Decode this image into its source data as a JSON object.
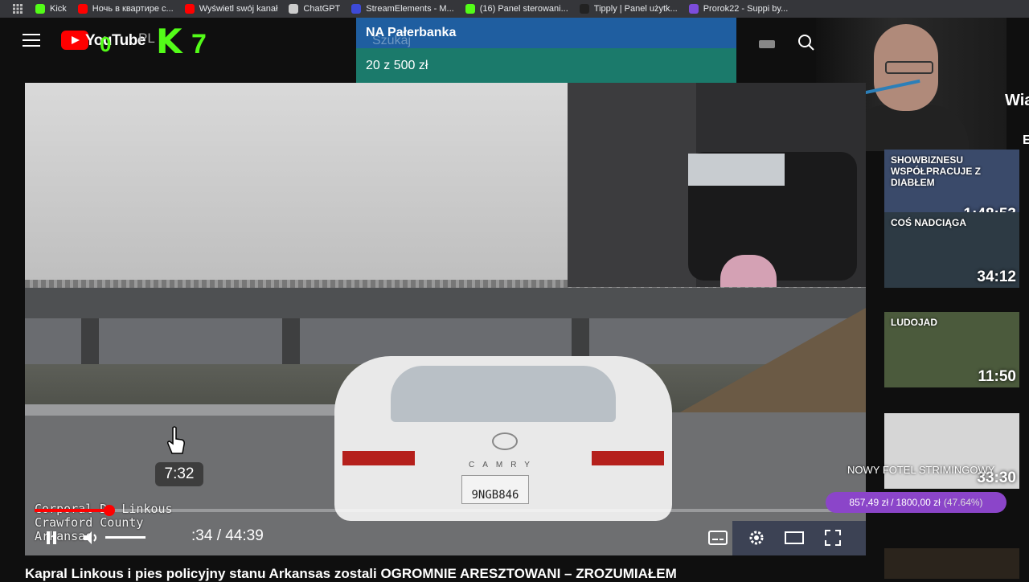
{
  "bookmarks": [
    {
      "label": "Kick",
      "color": "#53fc18"
    },
    {
      "label": "Ночь в квартире с...",
      "color": "#ff0000"
    },
    {
      "label": "Wyświetl swój kanał",
      "color": "#ff0000"
    },
    {
      "label": "ChatGPT",
      "color": "#cccccc"
    },
    {
      "label": "StreamElements - M...",
      "color": "#3d4ad8"
    },
    {
      "label": "(16) Panel sterowani...",
      "color": "#53fc18"
    },
    {
      "label": "Tipply | Panel użytk...",
      "color": "#222222"
    },
    {
      "label": "Prorok22 - Suppi by...",
      "color": "#7c4ddb"
    }
  ],
  "header": {
    "yt_text": "YouTube",
    "country": "PL",
    "kick_zero": "0",
    "kick_k": "K",
    "kick_seven": "7",
    "search_placeholder": "Szukaj"
  },
  "donation": {
    "title": "NA Pałerbanka",
    "amount": "20 z 500 zł"
  },
  "side_label": "Wia",
  "player": {
    "time_bubble": "7:32",
    "caption_lines": [
      "Corporal D. Linkous",
      "Crawford County",
      "Arkansas"
    ],
    "plate": "9NGB846",
    "car_brand": "CAMRY",
    "timecode": ":34 / 44:39",
    "progress_fraction": 0.09
  },
  "sidebar_videos": [
    {
      "headline": "SHOWBIZNESU WSPÓŁPRACUJE Z DIABŁEM",
      "duration": "1:48:53",
      "bg": "#3a4a6a"
    },
    {
      "headline": "COŚ NADCIĄGA",
      "duration": "34:12",
      "bg": "#2d3a44"
    },
    {
      "headline": "LUDOJAD",
      "duration": "11:50",
      "bg": "#4b5a3c"
    },
    {
      "headline": "",
      "duration": "33:30",
      "bg": "#d6d6d6"
    }
  ],
  "goal": {
    "label": "NOWY FOTEL STRIMINGOWY",
    "current": "857,49 zł",
    "target": "1800,00 zł",
    "percent_text": "(47.64%)",
    "fraction": 0.4764
  },
  "video_title": "Kapral Linkous i pies policyjny stanu Arkansas zostali OGROMNIE ARESZTOWANI – ZROZUMIAŁEM"
}
